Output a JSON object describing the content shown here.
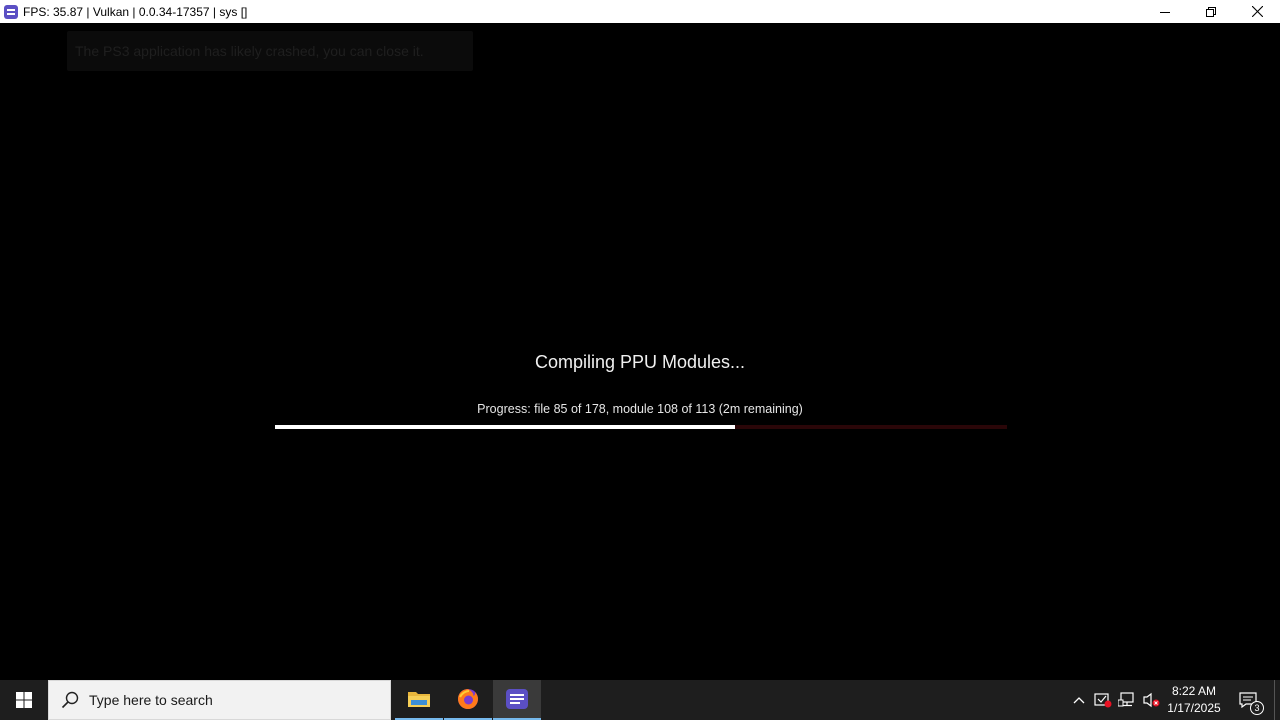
{
  "window": {
    "title": "FPS: 35.87 | Vulkan | 0.0.34-17357 | sys []",
    "icon": "rpcs3-app-icon"
  },
  "toast": {
    "message": "The PS3 application has likely crashed, you can close it."
  },
  "compile": {
    "title": "Compiling PPU Modules...",
    "progress_text": "Progress: file 85 of 178, module 108 of 113 (2m remaining)",
    "progress_fraction": 0.628
  },
  "taskbar": {
    "search_placeholder": "Type here to search",
    "apps": [
      "file-explorer-icon",
      "firefox-icon",
      "rpcs3-icon"
    ],
    "clock_time": "8:22 AM",
    "clock_date": "1/17/2025",
    "notification_count": "3"
  },
  "colors": {
    "accent_purple": "#5b4fc4",
    "progress_track": "#2a0608",
    "taskbar_bg": "#1e1e1e"
  }
}
